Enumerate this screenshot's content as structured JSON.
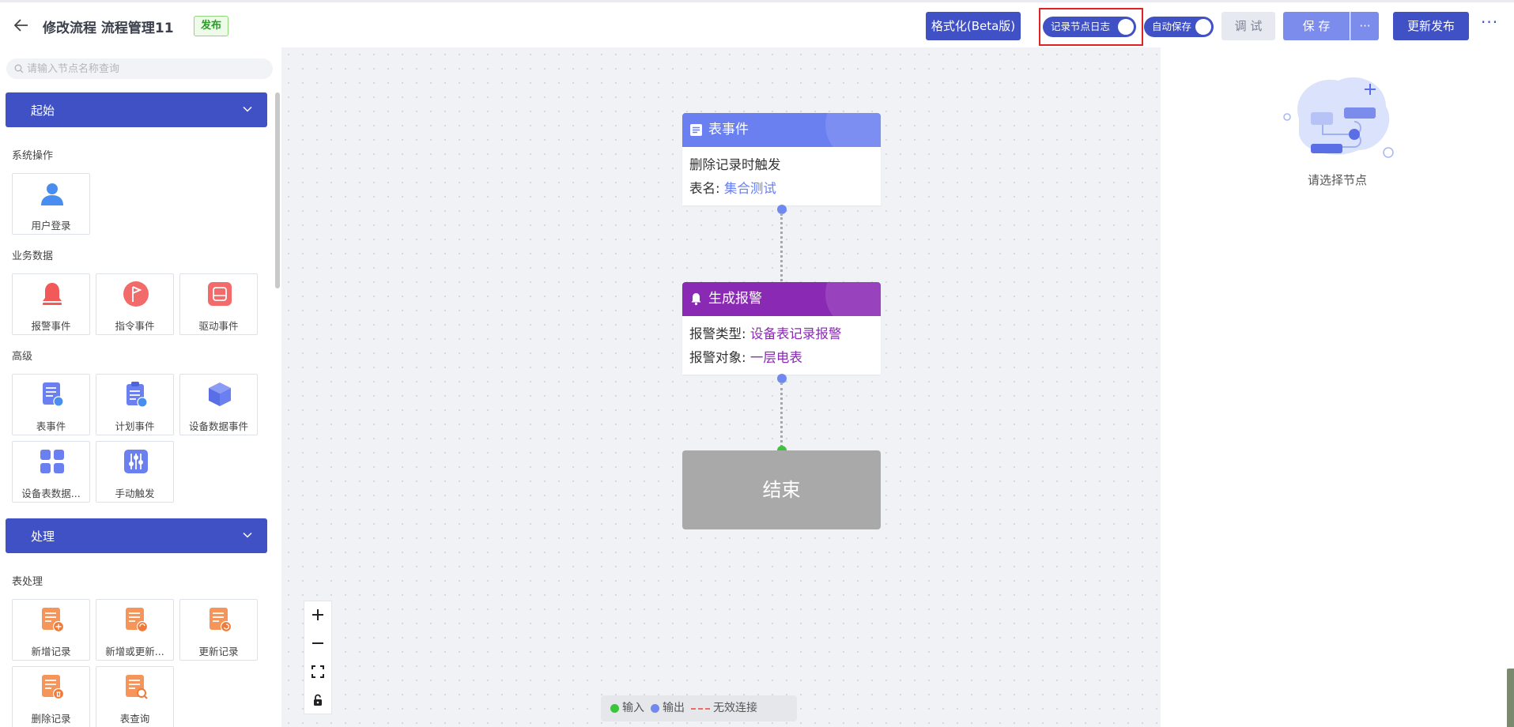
{
  "header": {
    "back_icon": "arrow-left-icon",
    "title": "修改流程 流程管理11",
    "status_badge": "发布",
    "format_button": "格式化(Beta版)",
    "log_toggle_label": "记录节点日志",
    "log_toggle_on": true,
    "autosave_toggle_label": "自动保存",
    "autosave_toggle_on": true,
    "debug_button": "调 试",
    "save_button": "保 存",
    "save_more": "···",
    "publish_button": "更新发布",
    "more_icon": "···"
  },
  "sidebar": {
    "search_placeholder": "请输入节点名称查询",
    "categories": [
      {
        "label": "起始",
        "sections": [
          {
            "label": "系统操作",
            "items": [
              {
                "label": "用户登录",
                "icon": "user-icon"
              }
            ]
          },
          {
            "label": "业务数据",
            "items": [
              {
                "label": "报警事件",
                "icon": "bell-icon"
              },
              {
                "label": "指令事件",
                "icon": "flag-icon"
              },
              {
                "label": "驱动事件",
                "icon": "drive-icon"
              }
            ]
          },
          {
            "label": "高级",
            "items": [
              {
                "label": "表事件",
                "icon": "table-event-icon"
              },
              {
                "label": "计划事件",
                "icon": "clipboard-icon"
              },
              {
                "label": "设备数据事件",
                "icon": "cube-icon"
              },
              {
                "label": "设备表数据...",
                "icon": "grid-icon"
              },
              {
                "label": "手动触发",
                "icon": "sliders-icon"
              }
            ]
          }
        ]
      },
      {
        "label": "处理",
        "sections": [
          {
            "label": "表处理",
            "items": [
              {
                "label": "新增记录",
                "icon": "doc-add-icon"
              },
              {
                "label": "新增或更新...",
                "icon": "doc-sync-icon"
              },
              {
                "label": "更新记录",
                "icon": "doc-refresh-icon"
              },
              {
                "label": "删除记录",
                "icon": "doc-delete-icon"
              },
              {
                "label": "表查询",
                "icon": "doc-search-icon"
              }
            ]
          }
        ]
      }
    ]
  },
  "canvas": {
    "nodes": [
      {
        "title": "表事件",
        "icon": "list-icon",
        "lines": [
          {
            "label": "删除记录时触发",
            "value": ""
          },
          {
            "label": "表名: ",
            "value": "集合测试"
          }
        ]
      },
      {
        "title": "生成报警",
        "icon": "bell-icon",
        "lines": [
          {
            "label": "报警类型: ",
            "value": "设备表记录报警"
          },
          {
            "label": "报警对象: ",
            "value": "一层电表"
          }
        ]
      },
      {
        "title": "结束"
      }
    ],
    "zoom_controls": [
      "plus-icon",
      "minus-icon",
      "fullscreen-icon",
      "lock-icon"
    ],
    "legend": {
      "input": "输入",
      "output": "输出",
      "invalid": "无效连接"
    }
  },
  "right_panel": {
    "empty_text": "请选择节点"
  },
  "colors": {
    "primary": "#3f51c4",
    "table_event": "#6a7ff0",
    "alarm": "#8a2ab4",
    "end": "#a9a9a9",
    "port_in": "#3cc43c",
    "port_out": "#6f89f0"
  }
}
